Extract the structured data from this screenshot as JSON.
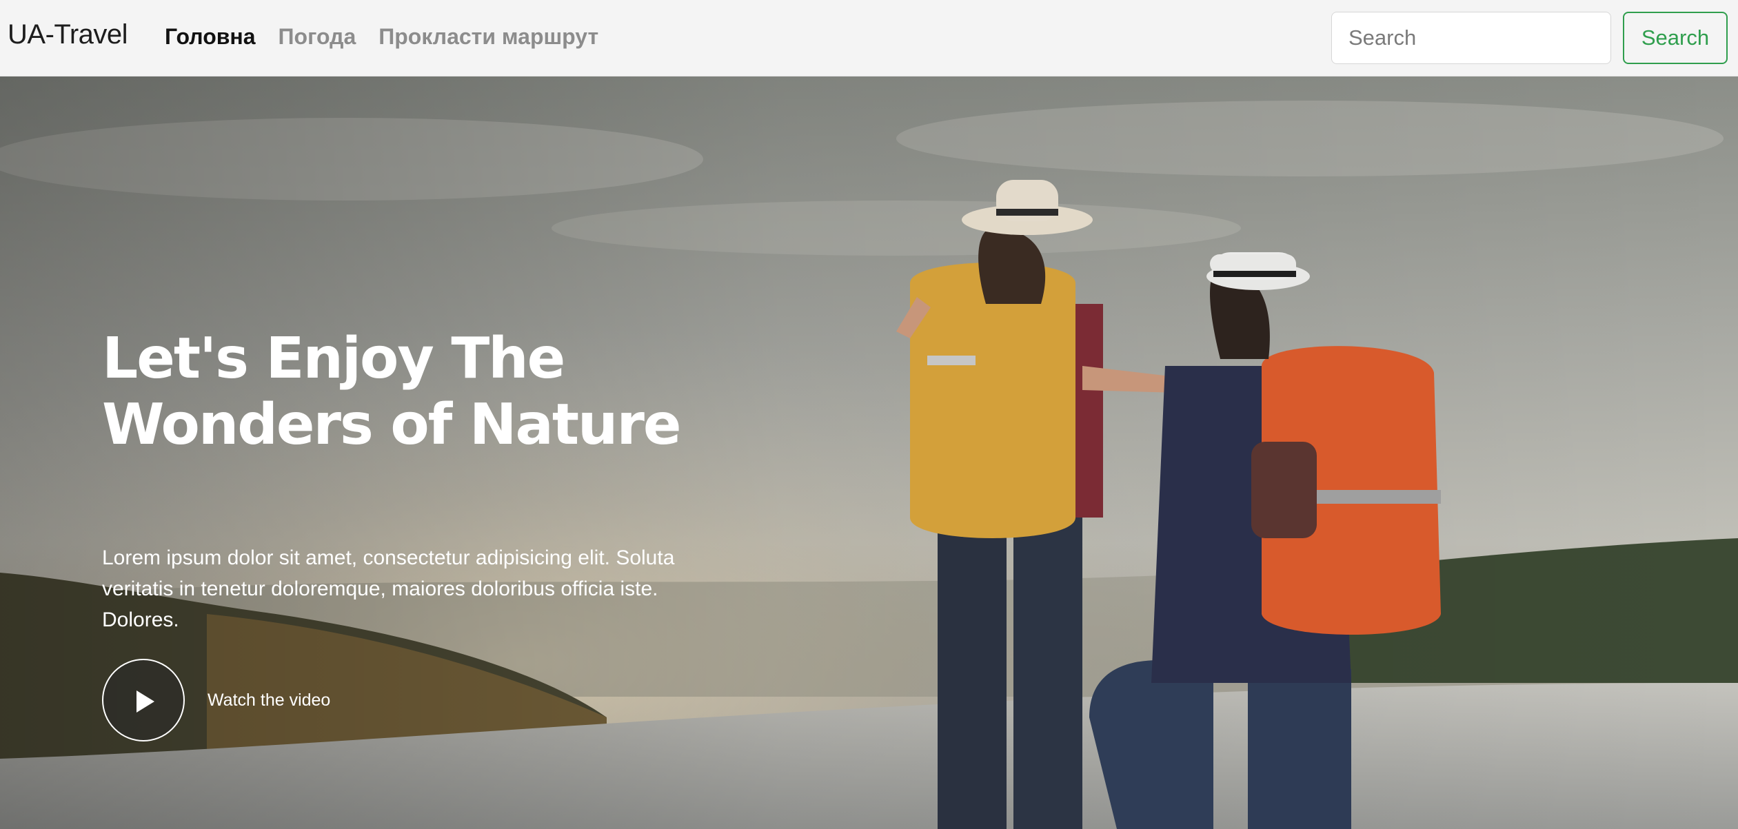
{
  "navbar": {
    "brand": "UA-Travel",
    "links": [
      "Головна",
      "Погода",
      "Прокласти маршрут"
    ],
    "search_placeholder": "Search",
    "search_button": "Search"
  },
  "hero": {
    "title": "Let's Enjoy The Wonders of Nature",
    "text": "Lorem ipsum dolor sit amet, consectetur adipisicing elit. Soluta veritatis in tenetur doloremque, maiores doloribus officia iste. Dolores.",
    "watch_label": "Watch the video",
    "image": "hikers-with-backpacks-by-lake-photo"
  },
  "colors": {
    "accent": "#2f9e4d",
    "nav_bg": "#f4f4f4",
    "active_link": "#111111",
    "inactive_link": "#8c8c8c"
  }
}
